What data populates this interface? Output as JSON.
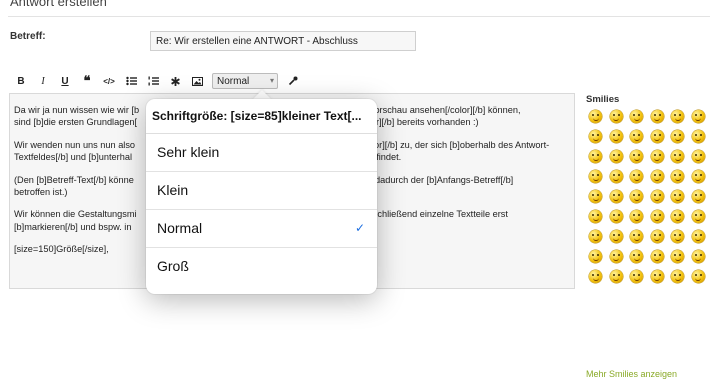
{
  "header": {
    "title": "Antwort erstellen"
  },
  "subject": {
    "label": "Betreff:",
    "value": "Re: Wir erstellen eine ANTWORT - Abschluss"
  },
  "toolbar": {
    "bold_label": "B",
    "italic_label": "I",
    "underline_label": "U",
    "quote_label": "❝",
    "code_label": "</>",
    "size_select_value": "Normal",
    "buttons": [
      "bold",
      "italic",
      "underline",
      "quote",
      "code",
      "bullet-list",
      "numbered-list",
      "asterisk",
      "image",
      "color"
    ]
  },
  "editor": {
    "paragraphs": [
      {
        "line1": "Da wir ja nun wissen wie wir [b",
        "line1_right": "er Vorschau ansehen[/color][/b] können,",
        "line2": "sind [b]die ersten Grundlagen[",
        "line2_right": "color][/b] bereits vorhanden  :)"
      },
      {
        "line1": "Wir wenden nun uns nun also",
        "line1_right": "or][/b] zu, der sich [b]oberhalb des Antwort-",
        "line2": "Textfeldes[/b] und [b]unterhal",
        "line2_right": "befindet."
      },
      {
        "line1": "(Den [b]Betreff-Text[/b] könne",
        "line1_right": "s dadurch der [b]Anfangs-Betreff[/b]",
        "line2": "betroffen ist.)",
        "line2_right": ""
      },
      {
        "line1": "Wir können die Gestaltungsmi",
        "line1_right": "anschließend einzelne Textteile erst",
        "line2": "[b]markieren[/b] und bspw. in",
        "line2_right": ""
      }
    ],
    "last_line": "[size=150]Größe[/size],"
  },
  "size_popup": {
    "title": "Schriftgröße: [size=85]kleiner Text[...",
    "options": [
      "Sehr klein",
      "Klein",
      "Normal",
      "Groß"
    ],
    "selected": "Normal",
    "check_mark": "✓"
  },
  "smilies": {
    "title": "Smilies",
    "count": 54,
    "more_link": "Mehr Smilies anzeigen"
  },
  "colors": {
    "link_green": "#8aaa28",
    "check_blue": "#1d6fe0"
  }
}
